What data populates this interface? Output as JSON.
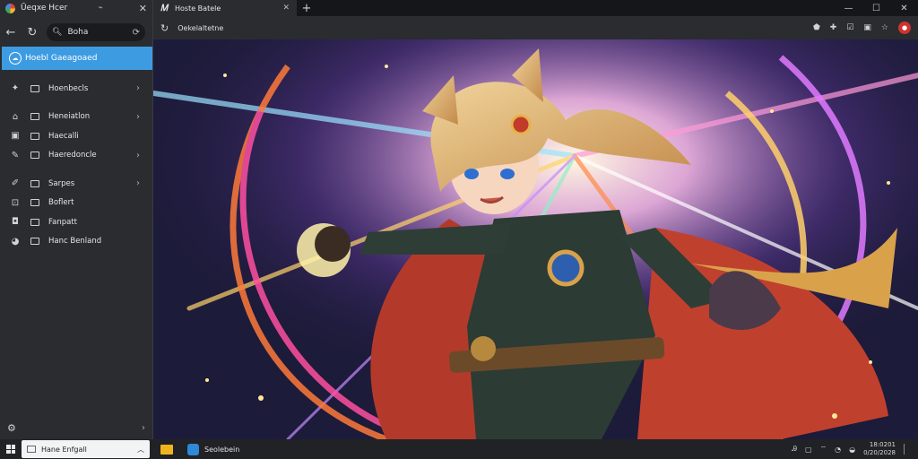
{
  "sidebar": {
    "app_title": "Ūeqxe Hcer",
    "search_value": "Boha",
    "selected_item": "Hoebl Gaeagoaed",
    "items": [
      {
        "label": "Hoenbecls",
        "icon": "puzzle-icon",
        "has_chevron": true
      },
      {
        "label": "Heneiatlon",
        "icon": "home-icon",
        "has_chevron": true
      },
      {
        "label": "Haecalli",
        "icon": "save-icon",
        "has_chevron": false
      },
      {
        "label": "Haeredoncle",
        "icon": "pen-icon",
        "has_chevron": true
      },
      {
        "label": "Sarpes",
        "icon": "brush-icon",
        "has_chevron": true
      },
      {
        "label": "Boflert",
        "icon": "square-icon",
        "has_chevron": false
      },
      {
        "label": "Fanpatt",
        "icon": "camera-icon",
        "has_chevron": false
      },
      {
        "label": "Hanc Benland",
        "icon": "palette-icon",
        "has_chevron": false
      }
    ]
  },
  "browser": {
    "tab_title": "Hoste Batele",
    "url": "Oekelaltetne"
  },
  "taskbar": {
    "search_text": "Hane Enfgall",
    "app_label": "Seolebein",
    "clock_time": "18:0201",
    "clock_date": "0/20/2028"
  },
  "icons": [
    "app-icon",
    "pin-icon",
    "close-icon",
    "back-icon",
    "refresh-icon",
    "search-icon",
    "chevron-right-icon",
    "add-tab-icon",
    "minimize-icon",
    "maximize-icon",
    "reload-icon",
    "extension-icon",
    "profile-icon",
    "windows-icon",
    "folder-icon"
  ],
  "colors": {
    "accent": "#3d9be2",
    "profile": "#d0322d"
  }
}
